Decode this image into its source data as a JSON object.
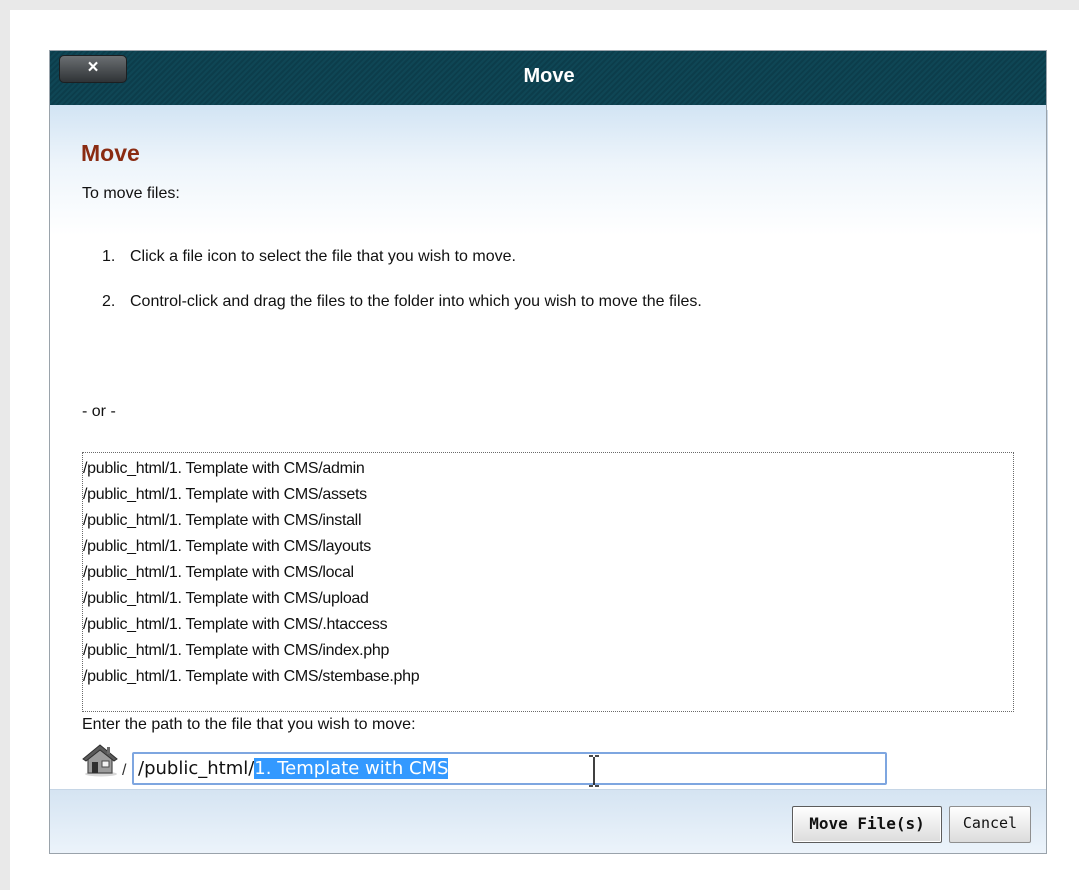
{
  "dialog": {
    "title": "Move",
    "close_label": "×"
  },
  "content": {
    "heading": "Move",
    "intro": "To move files:",
    "steps": [
      {
        "num": "1.",
        "text": "Click a file icon to select the file that you wish to move."
      },
      {
        "num": "2.",
        "text": "Control-click and drag the files to the folder into which you wish to move the files."
      }
    ],
    "or_text": "- or -",
    "files": [
      "/public_html/1. Template with CMS/admin",
      "/public_html/1. Template with CMS/assets",
      "/public_html/1. Template with CMS/install",
      "/public_html/1. Template with CMS/layouts",
      "/public_html/1. Template with CMS/local",
      "/public_html/1. Template with CMS/upload",
      "/public_html/1. Template with CMS/.htaccess",
      "/public_html/1. Template with CMS/index.php",
      "/public_html/1. Template with CMS/stembase.php"
    ],
    "path_label": "Enter the path to the file that you wish to move:",
    "path_root": "/",
    "path_input": {
      "unselected": "/public_html/",
      "selected": "1. Template with CMS"
    }
  },
  "footer": {
    "move_label": "Move File(s)",
    "cancel_label": "Cancel"
  },
  "colors": {
    "titlebar": "#0f4655",
    "heading": "#8a2b12",
    "selection": "#3399ff",
    "input_border": "#7ea6e0"
  },
  "icons": {
    "close": "close-icon",
    "home": "home-icon",
    "cursor": "text-cursor-icon"
  }
}
